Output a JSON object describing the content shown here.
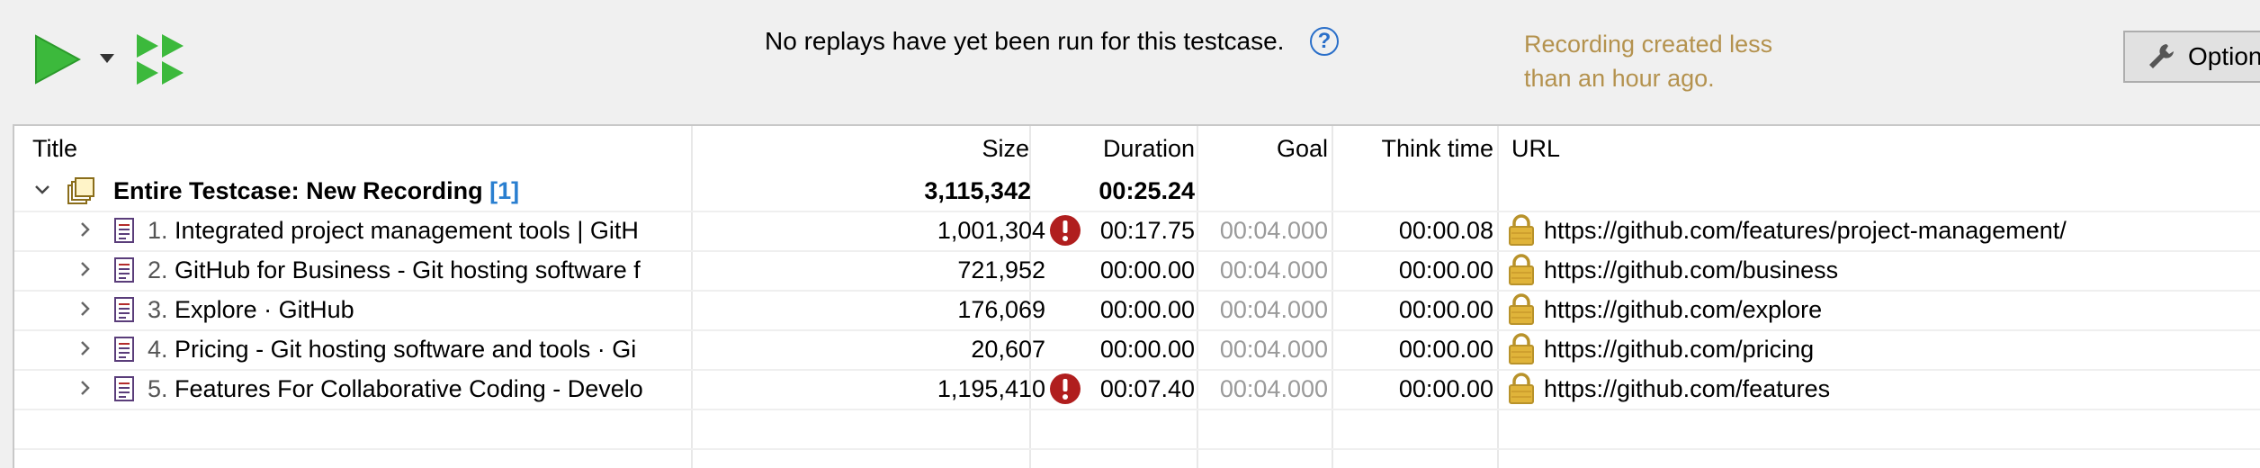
{
  "toolbar": {
    "status_message": "No replays have yet been run for this testcase.",
    "help_glyph": "?",
    "recording_note_line1": "Recording created less",
    "recording_note_line2": "than an hour ago.",
    "options_label": "Options",
    "play_color": "#3cb93c"
  },
  "table": {
    "columns": {
      "title": "Title",
      "size": "Size",
      "duration": "Duration",
      "goal": "Goal",
      "think_time": "Think time",
      "url": "URL"
    },
    "summary": {
      "label": "Entire Testcase: New Recording",
      "count": "[1]",
      "size": "3,115,342",
      "duration": "00:25.24"
    },
    "rows": [
      {
        "num": "1.",
        "title": "Integrated project management tools | GitH",
        "size": "1,001,304",
        "error": true,
        "duration": "00:17.75",
        "goal": "00:04.000",
        "think_time": "00:00.08",
        "url": "https://github.com/features/project-management/"
      },
      {
        "num": "2.",
        "title": "GitHub for Business - Git hosting software f",
        "size": "721,952",
        "error": false,
        "duration": "00:00.00",
        "goal": "00:04.000",
        "think_time": "00:00.00",
        "url": "https://github.com/business"
      },
      {
        "num": "3.",
        "title": "Explore · GitHub",
        "size": "176,069",
        "error": false,
        "duration": "00:00.00",
        "goal": "00:04.000",
        "think_time": "00:00.00",
        "url": "https://github.com/explore"
      },
      {
        "num": "4.",
        "title": "Pricing - Git hosting software and tools · Gi",
        "size": "20,607",
        "error": false,
        "duration": "00:00.00",
        "goal": "00:04.000",
        "think_time": "00:00.00",
        "url": "https://github.com/pricing"
      },
      {
        "num": "5.",
        "title": "Features For Collaborative Coding - Develo",
        "size": "1,195,410",
        "error": true,
        "duration": "00:07.40",
        "goal": "00:04.000",
        "think_time": "00:00.00",
        "url": "https://github.com/features"
      }
    ]
  },
  "icons": {
    "play": "play-icon",
    "dropdown": "caret-down-icon",
    "play_all": "double-play-icon",
    "help": "help-icon",
    "options": "wrench-icon",
    "expand": "chevron-right-icon",
    "collapse": "chevron-down-icon",
    "page": "document-icon",
    "testcase": "stack-icon",
    "error": "error-icon",
    "secure": "lock-icon"
  },
  "colors": {
    "accent_green": "#3cb93c",
    "error_red": "#b01e1e",
    "link_blue": "#2a7fd0",
    "note_gold": "#b4924e",
    "lock_gold": "#e0b43a"
  }
}
